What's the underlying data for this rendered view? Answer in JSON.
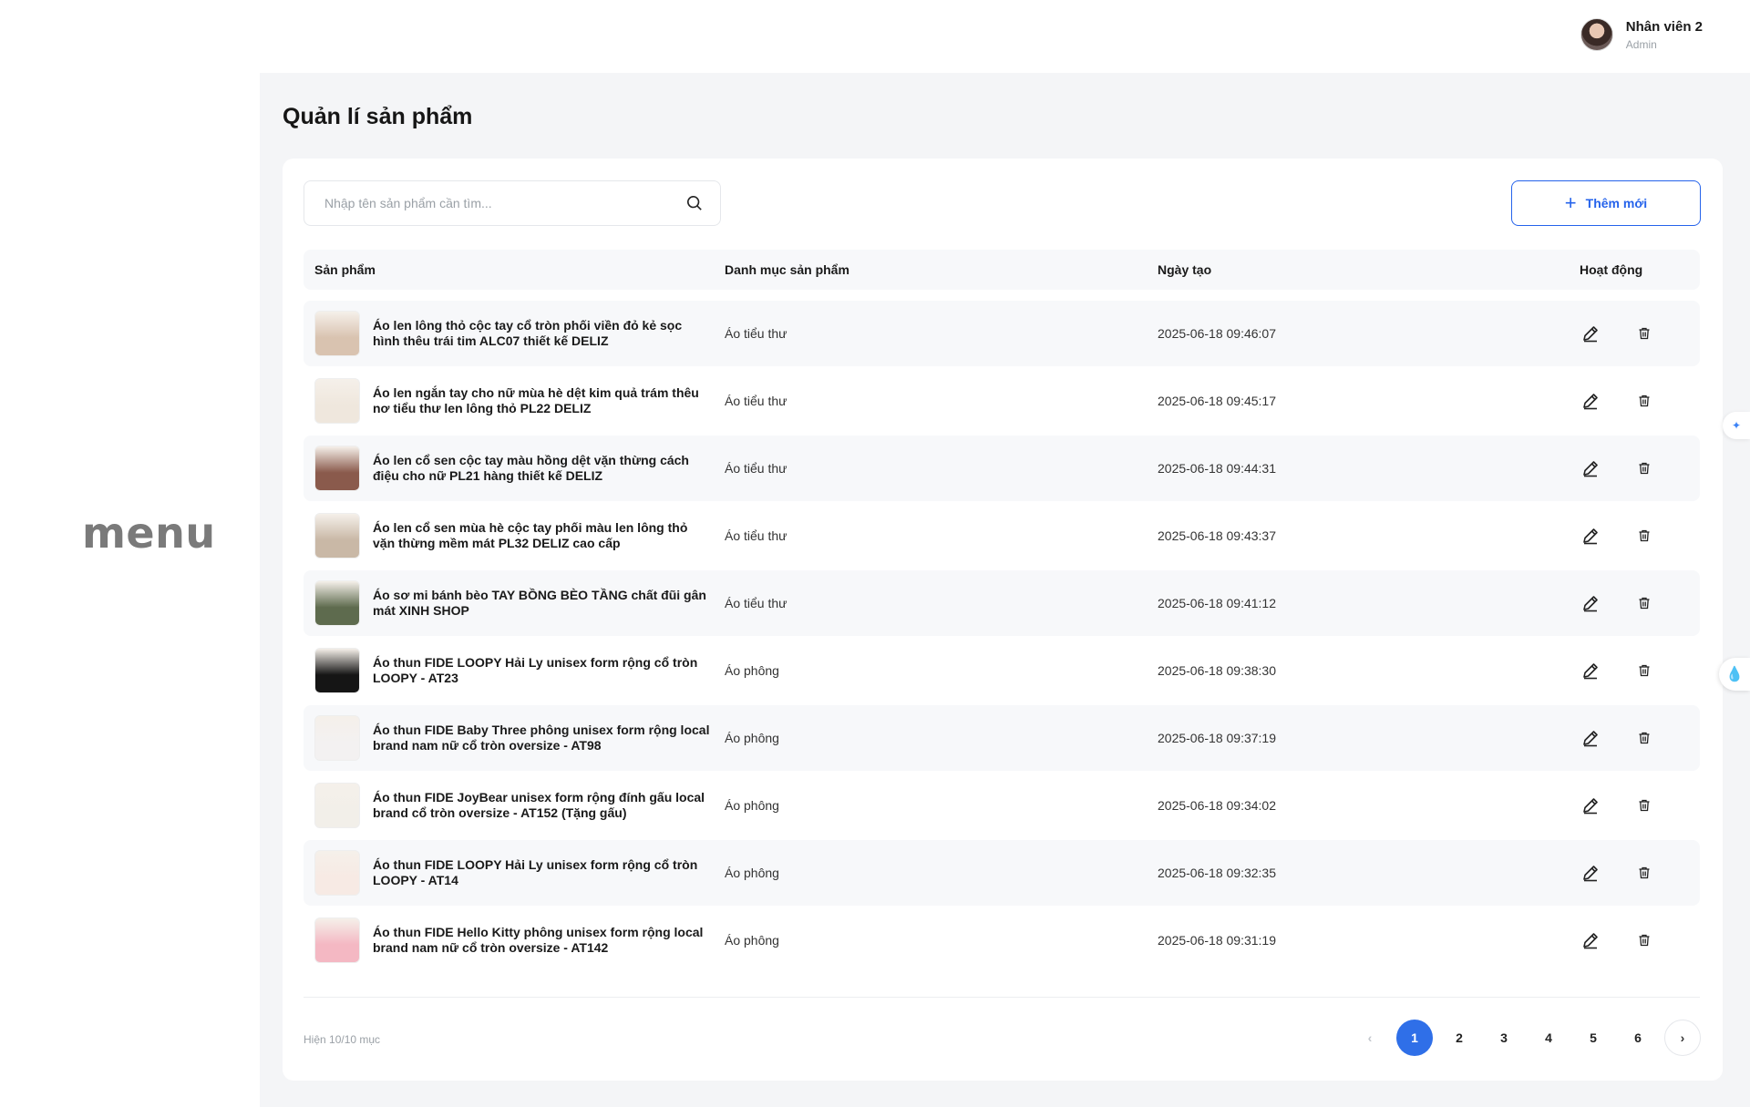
{
  "sidebar": {
    "menu_text": "menu"
  },
  "header": {
    "user_name": "Nhân viên 2",
    "user_role": "Admin"
  },
  "page": {
    "title": "Quản lí sản phẩm"
  },
  "toolbar": {
    "search_placeholder": "Nhập tên sản phẩm cần tìm...",
    "search_value": "",
    "add_label": "Thêm mới",
    "add_icon": "+"
  },
  "table": {
    "columns": {
      "product": "Sản phẩm",
      "category": "Danh mục sản phẩm",
      "created": "Ngày tạo",
      "actions": "Hoạt động"
    },
    "rows": [
      {
        "name": "Áo len lông thỏ cộc tay cổ tròn phối viền đỏ kẻ sọc hình thêu trái tim ALC07 thiết kế DELIZ",
        "category": "Áo tiểu thư",
        "created": "2025-06-18 09:46:07",
        "thumb_color": "#d9c3b0"
      },
      {
        "name": "Áo len ngắn tay cho nữ mùa hè dệt kim quả trám thêu nơ tiểu thư len lông thỏ PL22 DELIZ",
        "category": "Áo tiểu thư",
        "created": "2025-06-18 09:45:17",
        "thumb_color": "#efe7dd"
      },
      {
        "name": "Áo len cổ sen cộc tay màu hồng dệt vặn thừng cách điệu cho nữ PL21 hàng thiết kế DELIZ",
        "category": "Áo tiểu thư",
        "created": "2025-06-18 09:44:31",
        "thumb_color": "#8a5a4c"
      },
      {
        "name": "Áo len cổ sen mùa hè cộc tay phối màu len lông thỏ vặn thừng mềm mát PL32 DELIZ cao cấp",
        "category": "Áo tiểu thư",
        "created": "2025-06-18 09:43:37",
        "thumb_color": "#c9b8a6"
      },
      {
        "name": "Áo sơ mi bánh bèo TAY BỒNG BÈO TẦNG chất đũi gân mát XINH SHOP",
        "category": "Áo tiểu thư",
        "created": "2025-06-18 09:41:12",
        "thumb_color": "#5e6b4e"
      },
      {
        "name": "Áo thun FIDE LOOPY Hải Ly unisex form rộng cổ tròn LOOPY - AT23",
        "category": "Áo phông",
        "created": "2025-06-18 09:38:30",
        "thumb_color": "#151515"
      },
      {
        "name": "Áo thun FIDE Baby Three phông unisex form rộng local brand nam nữ cổ tròn oversize - AT98",
        "category": "Áo phông",
        "created": "2025-06-18 09:37:19",
        "thumb_color": "#f3f1f1"
      },
      {
        "name": "Áo thun FIDE JoyBear unisex form rộng đính gấu local brand cổ tròn oversize - AT152 (Tặng gấu)",
        "category": "Áo phông",
        "created": "2025-06-18 09:34:02",
        "thumb_color": "#f2efe9"
      },
      {
        "name": "Áo thun FIDE LOOPY Hải Ly unisex form rộng cổ tròn LOOPY - AT14",
        "category": "Áo phông",
        "created": "2025-06-18 09:32:35",
        "thumb_color": "#f7eae4"
      },
      {
        "name": "Áo thun FIDE Hello Kitty phông unisex form rộng local brand nam nữ cổ tròn oversize - AT142",
        "category": "Áo phông",
        "created": "2025-06-18 09:31:19",
        "thumb_color": "#f4b8c3"
      }
    ]
  },
  "footer": {
    "count_text": "Hiện 10/10 mục"
  },
  "pagination": {
    "prev": "‹",
    "pages": [
      "1",
      "2",
      "3",
      "4",
      "5",
      "6"
    ],
    "active": "1",
    "next": "›"
  },
  "colors": {
    "accent": "#2563eb",
    "active_page": "#2f6fe8",
    "background": "#f4f5f7"
  }
}
